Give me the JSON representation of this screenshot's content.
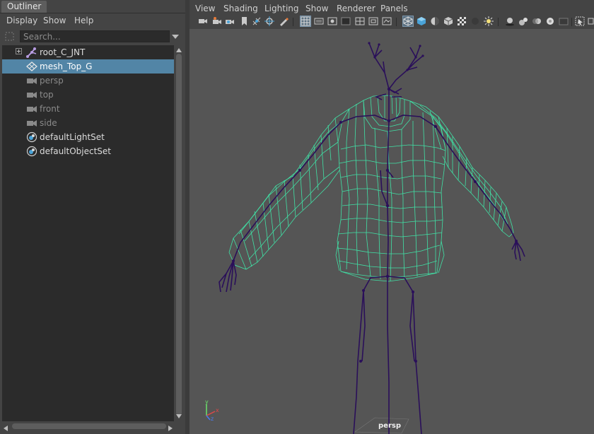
{
  "outliner": {
    "tab_label": "Outliner",
    "menu": [
      "Display",
      "Show",
      "Help"
    ],
    "search": {
      "placeholder": "Search...",
      "value": ""
    },
    "items": [
      {
        "label": "root_C_JNT",
        "icon": "joint-icon",
        "expandable": true,
        "selected": false,
        "dimmed": false
      },
      {
        "label": "mesh_Top_G",
        "icon": "group-icon",
        "expandable": false,
        "selected": true,
        "dimmed": false
      },
      {
        "label": "persp",
        "icon": "camera-icon",
        "expandable": false,
        "selected": false,
        "dimmed": true
      },
      {
        "label": "top",
        "icon": "camera-icon",
        "expandable": false,
        "selected": false,
        "dimmed": true
      },
      {
        "label": "front",
        "icon": "camera-icon",
        "expandable": false,
        "selected": false,
        "dimmed": true
      },
      {
        "label": "side",
        "icon": "camera-icon",
        "expandable": false,
        "selected": false,
        "dimmed": true
      },
      {
        "label": "defaultLightSet",
        "icon": "set-icon",
        "expandable": false,
        "selected": false,
        "dimmed": false
      },
      {
        "label": "defaultObjectSet",
        "icon": "set-icon",
        "expandable": false,
        "selected": false,
        "dimmed": false
      }
    ]
  },
  "viewport": {
    "menu": [
      "View",
      "Shading",
      "Lighting",
      "Show",
      "Renderer",
      "Panels"
    ],
    "camera_label": "persp",
    "axis": {
      "x": "x",
      "y": "y",
      "z": "z"
    }
  },
  "colors": {
    "wireframe": "#40e2a6",
    "joints": "#2a0f5a",
    "selection": "#5285a6",
    "viewport_bg": "#555555"
  }
}
